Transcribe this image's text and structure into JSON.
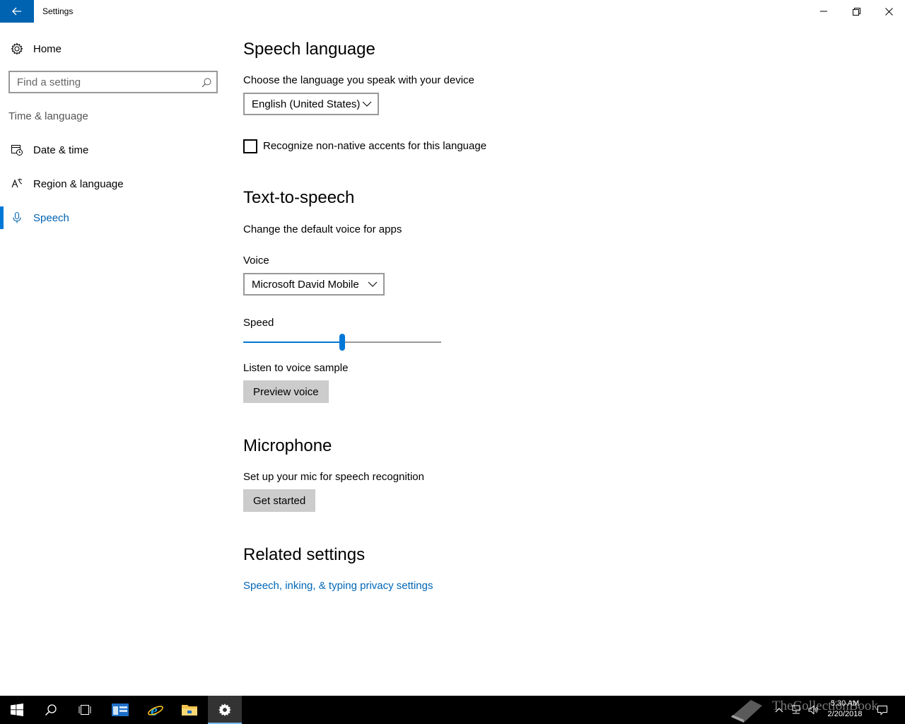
{
  "window": {
    "title": "Settings"
  },
  "sidebar": {
    "home_label": "Home",
    "search_placeholder": "Find a setting",
    "group_label": "Time & language",
    "items": [
      {
        "label": "Date & time",
        "icon": "calendar-clock-icon"
      },
      {
        "label": "Region & language",
        "icon": "language-icon"
      },
      {
        "label": "Speech",
        "icon": "microphone-icon",
        "selected": true
      }
    ]
  },
  "speech_language": {
    "heading": "Speech language",
    "description": "Choose the language you speak with your device",
    "language_value": "English (United States)",
    "accent_checkbox_label": "Recognize non-native accents for this language",
    "accent_checked": false
  },
  "tts": {
    "heading": "Text-to-speech",
    "description": "Change the default voice for apps",
    "voice_label": "Voice",
    "voice_value": "Microsoft David Mobile",
    "speed_label": "Speed",
    "speed_level": 0.5,
    "sample_label": "Listen to voice sample",
    "preview_button": "Preview voice"
  },
  "microphone": {
    "heading": "Microphone",
    "description": "Set up your mic for speech recognition",
    "button": "Get started"
  },
  "related": {
    "heading": "Related settings",
    "link": "Speech, inking, & typing privacy settings"
  },
  "taskbar": {
    "watermark": "TheCollectionBook",
    "time": "5:30 AM",
    "date": "2/20/2018"
  },
  "colors": {
    "accent": "#0078d7",
    "title_back": "#0063b1",
    "link": "#0067b8"
  }
}
